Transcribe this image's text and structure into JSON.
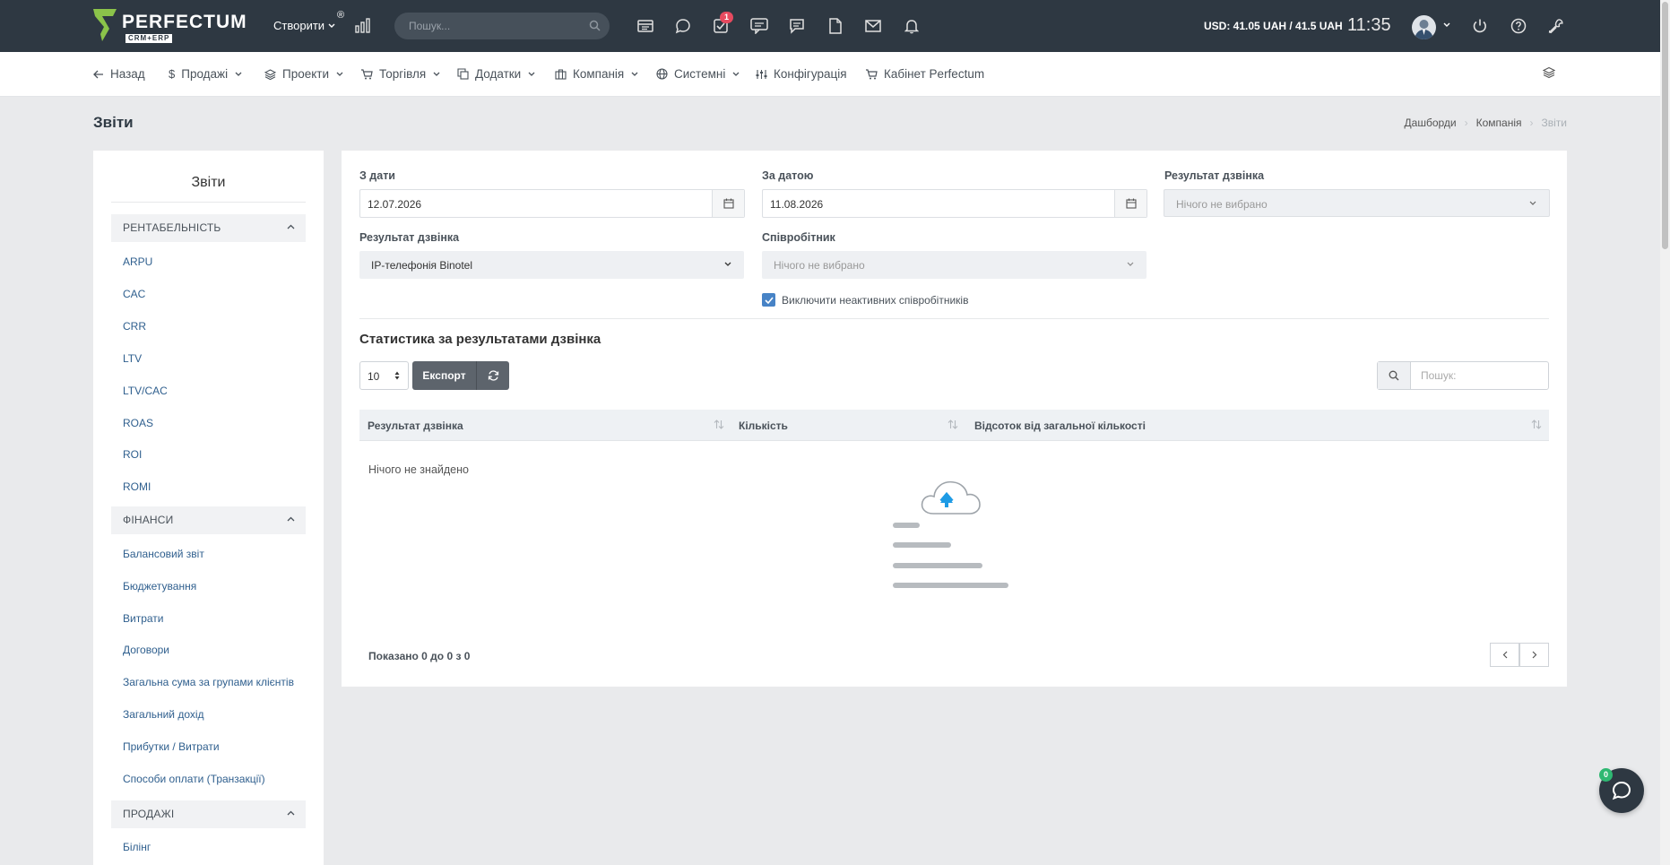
{
  "topbar": {
    "logo_text": "PERFECTUM",
    "logo_sub": "CRM+ERP",
    "logo_reg": "®",
    "create_label": "Створити",
    "search_placeholder": "Пошук...",
    "tasks_badge": "1",
    "currency": "USD: 41.05 UAH / 41.5 UAH",
    "time": "11:35",
    "icons": [
      "chart-icon",
      "search-icon",
      "news-icon",
      "chat-icon",
      "tasks-icon",
      "support-icon",
      "comments-icon",
      "file-icon",
      "mail-icon",
      "bell-icon",
      "power-icon",
      "help-icon",
      "wrench-icon"
    ]
  },
  "nav": {
    "back": "Назад",
    "sales": "Продажі",
    "projects": "Проекти",
    "trade": "Торгівля",
    "addons": "Додатки",
    "company": "Компанія",
    "system": "Системні",
    "config": "Конфігурація",
    "cabinet": "Кабінет Perfectum"
  },
  "page": {
    "title": "Звіти",
    "breadcrumb": [
      "Дашборди",
      "Компанія",
      "Звіти"
    ]
  },
  "sidebar": {
    "title": "Звіти",
    "sections": [
      {
        "label": "РЕНТАБЕЛЬНІСТЬ",
        "items": [
          "ARPU",
          "CAC",
          "CRR",
          "LTV",
          "LTV/CAC",
          "ROAS",
          "ROI",
          "ROMI"
        ]
      },
      {
        "label": "ФІНАНСИ",
        "items": [
          "Балансовий звіт",
          "Бюджетування",
          "Витрати",
          "Договори",
          "Загальна сума за групами клієнтів",
          "Загальний дохід",
          "Прибутки / Витрати",
          "Способи оплати (Транзакції)"
        ]
      },
      {
        "label": "ПРОДАЖІ",
        "items": [
          "Білінг"
        ]
      }
    ]
  },
  "filters": {
    "from_label": "З дати",
    "from_value": "12.07.2026",
    "to_label": "За датою",
    "to_value": "11.08.2026",
    "result_label": "Результат дзвінка",
    "result_value": "Нічого не вибрано",
    "result2_label": "Результат дзвінка",
    "result2_value": "IP-телефонія Binotel",
    "employee_label": "Співробітник",
    "employee_value": "Нічого не вибрано",
    "exclude_inactive_label": "Виключити неактивних співробітників",
    "exclude_inactive_checked": true
  },
  "table": {
    "section_title": "Статистика за результатами дзвінка",
    "page_size": "10",
    "export_label": "Експорт",
    "search_placeholder": "Пошук:",
    "columns": [
      "Результат дзвінка",
      "Кількість",
      "Відсоток від загальної кількості"
    ],
    "empty_text": "Нічого не знайдено",
    "info": "Показано 0 до 0 з 0"
  },
  "chat": {
    "badge": "0"
  },
  "colors": {
    "topbar": "#2e3842",
    "accent_green": "#8bc34a",
    "link": "#2f5f8e",
    "checkbox": "#4783c6",
    "badge_red": "#e64a5f",
    "upload_blue": "#1e9be5"
  }
}
